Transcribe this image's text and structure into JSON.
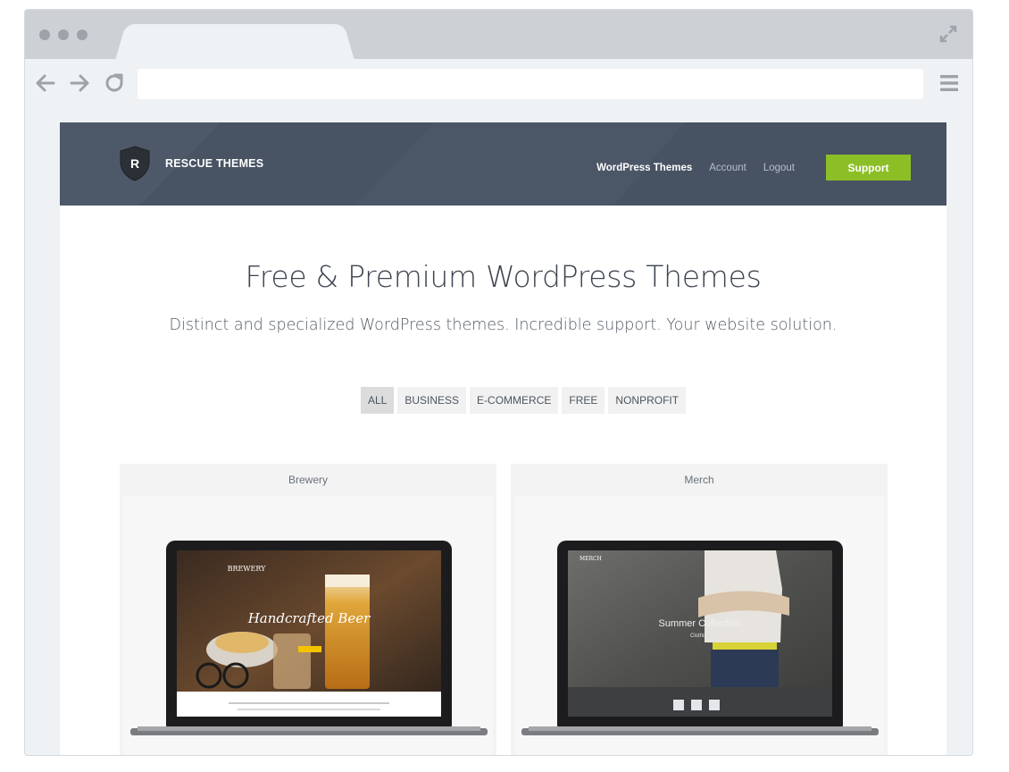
{
  "browser": {
    "url": "",
    "icons": [
      "back-arrow-icon",
      "forward-arrow-icon",
      "reload-icon",
      "menu-icon",
      "expand-icon"
    ]
  },
  "site": {
    "brand": "RESCUE THEMES",
    "logo_letter": "R",
    "nav": {
      "primary": "WordPress Themes",
      "account": "Account",
      "logout": "Logout",
      "support": "Support"
    },
    "colors": {
      "header": "#4a5565",
      "accent": "#8cbf26"
    },
    "hero": {
      "title": "Free & Premium WordPress Themes",
      "subtitle": "Distinct and specialized WordPress themes. Incredible support. Your website solution."
    },
    "filters": [
      {
        "label": "ALL",
        "active": true
      },
      {
        "label": "BUSINESS",
        "active": false
      },
      {
        "label": "E-COMMERCE",
        "active": false
      },
      {
        "label": "FREE",
        "active": false
      },
      {
        "label": "NONPROFIT",
        "active": false
      }
    ],
    "themes": [
      {
        "name": "Brewery",
        "screen_brand": "BREWERY",
        "screen_headline": "Handcrafted Beer"
      },
      {
        "name": "Merch",
        "screen_brand": "MERCH",
        "screen_headline": "Summer Collection",
        "screen_subline": "Clothing"
      }
    ]
  }
}
